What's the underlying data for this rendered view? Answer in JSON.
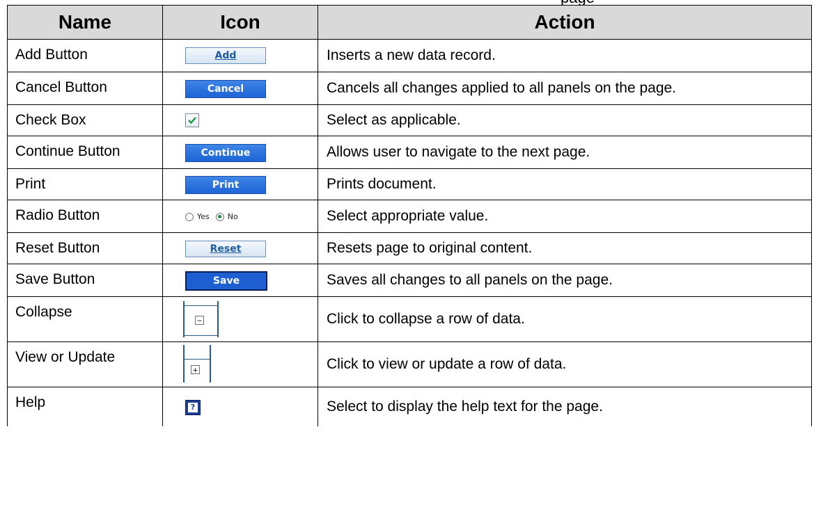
{
  "table": {
    "headers": {
      "name": "Name",
      "icon": "Icon",
      "action": "Action"
    },
    "rows": [
      {
        "name": "Add Button",
        "icon_type": "button-light",
        "icon_label": "Add",
        "action": "Inserts a new data record."
      },
      {
        "name": "Cancel Button",
        "icon_type": "button-dark",
        "icon_label": "Cancel",
        "action": "Cancels all changes applied to all panels on the page."
      },
      {
        "name": "Check Box",
        "icon_type": "checkbox",
        "action": "Select as applicable."
      },
      {
        "name": "Continue Button",
        "icon_type": "button-dark",
        "icon_label": "Continue",
        "action": "Allows user to navigate to the next page."
      },
      {
        "name": "Print",
        "icon_type": "button-dark",
        "icon_label": "Print",
        "action": "Prints document."
      },
      {
        "name": "Radio Button",
        "icon_type": "radio",
        "radio_options": [
          "Yes",
          "No"
        ],
        "radio_selected": "No",
        "action": "Select appropriate value."
      },
      {
        "name": "Reset Button",
        "icon_type": "button-light",
        "icon_label": "Reset",
        "action": "Resets page to original content."
      },
      {
        "name": "Save Button",
        "icon_type": "button-navy",
        "icon_label": "Save",
        "action": "Saves all changes to all panels on the page."
      },
      {
        "name": "Collapse",
        "icon_type": "tree-collapse",
        "icon_glyph": "−",
        "action": "Click to collapse a row of data."
      },
      {
        "name": "View or Update",
        "icon_type": "tree-expand",
        "icon_glyph": "+",
        "action": "Click to view or update a row of data."
      },
      {
        "name": "Help",
        "icon_type": "help",
        "icon_glyph": "?",
        "action": "Select to display the help text for the page."
      }
    ]
  },
  "colors": {
    "header_bg": "#d9d9d9",
    "button_dark": "#1d63d6",
    "button_light_text": "#1f5c9e",
    "help_bg": "#1a3f99"
  },
  "page_fragment_text": "page"
}
